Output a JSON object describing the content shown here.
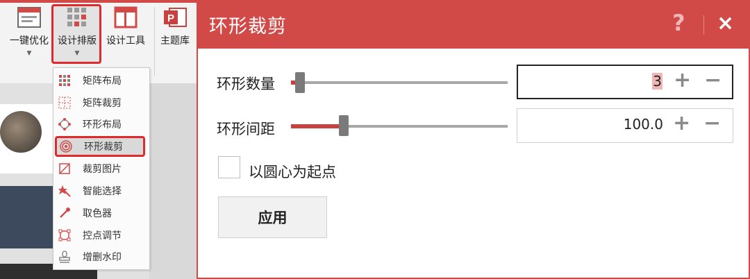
{
  "ribbon": {
    "buttons": [
      {
        "label": "一键优化",
        "icon": "one-click-optimize-icon"
      },
      {
        "label": "设计排版",
        "icon": "design-layout-icon",
        "selected": true
      },
      {
        "label": "设计工具",
        "icon": "design-tools-icon"
      },
      {
        "label": "主题库",
        "icon": "powerpoint-icon"
      }
    ]
  },
  "menu": {
    "items": [
      {
        "label": "矩阵布局",
        "icon": "matrix-layout-icon"
      },
      {
        "label": "矩阵裁剪",
        "icon": "matrix-crop-icon"
      },
      {
        "label": "环形布局",
        "icon": "ring-layout-icon"
      },
      {
        "label": "环形裁剪",
        "icon": "ring-crop-icon",
        "selected": true
      },
      {
        "label": "裁剪图片",
        "icon": "crop-image-icon"
      },
      {
        "label": "智能选择",
        "icon": "smart-select-icon"
      },
      {
        "label": "取色器",
        "icon": "eyedropper-icon"
      },
      {
        "label": "控点调节",
        "icon": "handle-adjust-icon"
      },
      {
        "label": "增删水印",
        "icon": "watermark-icon"
      }
    ]
  },
  "dialog": {
    "title": "环形裁剪",
    "help": "?",
    "close": "×",
    "ring_count": {
      "label": "环形数量",
      "value": "3",
      "slider_fraction": 0.02
    },
    "ring_spacing": {
      "label": "环形间距",
      "value": "100.0",
      "slider_fraction": 0.22
    },
    "plus": "+",
    "minus": "−",
    "center_start": {
      "label": "以圆心为起点",
      "checked": false
    },
    "apply": "应用"
  },
  "colors": {
    "accent": "#d24a48",
    "highlight_border": "#e0292b"
  }
}
